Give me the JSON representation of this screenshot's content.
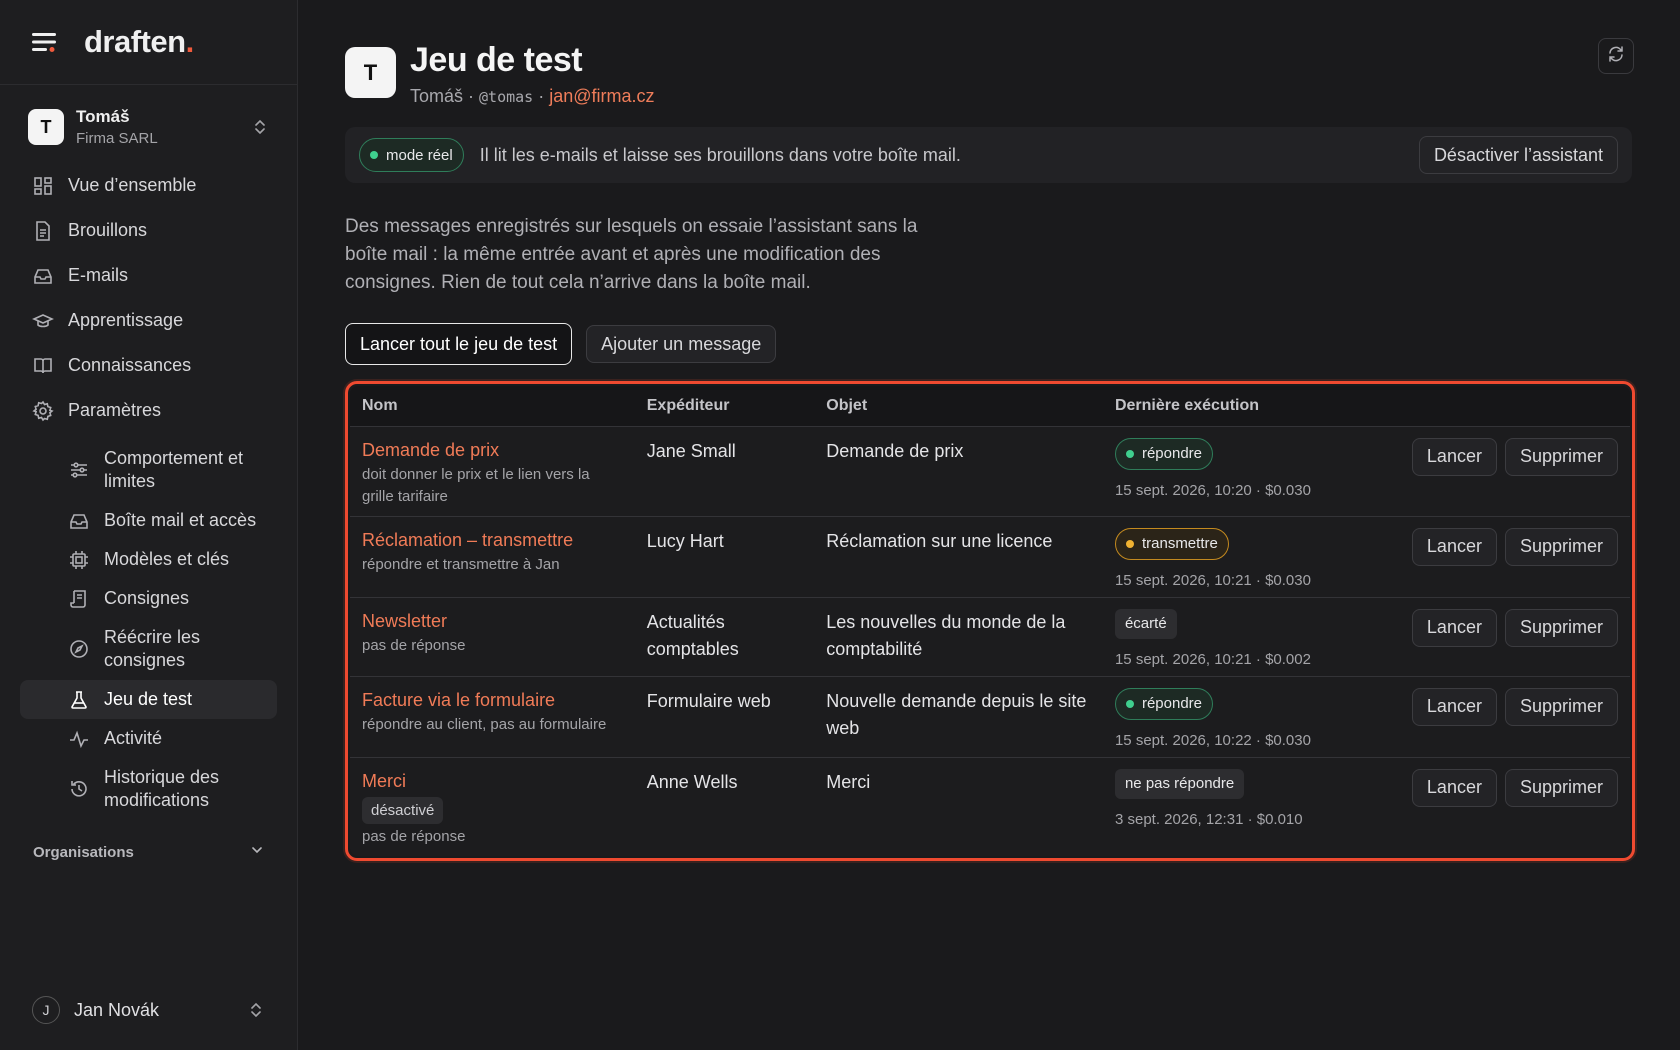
{
  "brand": {
    "name": "draften",
    "dot": "."
  },
  "account": {
    "initial": "T",
    "name": "Tomáš",
    "org": "Firma SARL"
  },
  "nav": [
    {
      "label": "Vue d’ensemble",
      "icon": "grid-icon"
    },
    {
      "label": "Brouillons",
      "icon": "document-icon"
    },
    {
      "label": "E-mails",
      "icon": "inbox-icon"
    },
    {
      "label": "Apprentissage",
      "icon": "graduation-cap-icon"
    },
    {
      "label": "Connaissances",
      "icon": "book-icon"
    },
    {
      "label": "Paramètres",
      "icon": "gear-icon"
    }
  ],
  "subnav": [
    {
      "label": "Comportement et limites",
      "icon": "sliders-icon"
    },
    {
      "label": "Boîte mail et accès",
      "icon": "inbox-icon"
    },
    {
      "label": "Modèles et clés",
      "icon": "chip-icon"
    },
    {
      "label": "Consignes",
      "icon": "scroll-icon"
    },
    {
      "label": "Réécrire les consignes",
      "icon": "compass-icon"
    },
    {
      "label": "Jeu de test",
      "icon": "flask-icon",
      "active": true
    },
    {
      "label": "Activité",
      "icon": "activity-icon"
    },
    {
      "label": "Historique des modifications",
      "icon": "history-icon"
    }
  ],
  "organisations_label": "Organisations",
  "user": {
    "initial": "J",
    "name": "Jan Novák"
  },
  "page": {
    "avatar": "T",
    "title": "Jeu de test",
    "meta_name": "Tomáš · ",
    "meta_handle": "@tomas",
    "meta_sep": " · ",
    "meta_email": "jan@firma.cz"
  },
  "banner": {
    "mode": "mode réel",
    "text": "Il lit les e-mails et laisse ses brouillons dans votre boîte mail.",
    "button": "Désactiver l’assistant"
  },
  "description": "Des messages enregistrés sur lesquels on essaie l’assistant sans la boîte mail : la même entrée avant et après une modification des consignes. Rien de tout cela n’arrive dans la boîte mail.",
  "actions": {
    "run_all": "Lancer tout le jeu de test",
    "add_message": "Ajouter un message"
  },
  "table": {
    "headers": [
      "Nom",
      "Expéditeur",
      "Objet",
      "Dernière exécution",
      ""
    ],
    "run_label": "Lancer",
    "delete_label": "Supprimer",
    "rows": [
      {
        "name": "Demande de prix",
        "tag": "",
        "note": "doit donner le prix et le lien vers la grille tarifaire",
        "sender": "Jane Small",
        "subject": "Demande de prix",
        "status": "répondre",
        "status_color": "green",
        "run": "15 sept. 2026, 10:20 · $0.030"
      },
      {
        "name": "Réclamation – transmettre",
        "tag": "",
        "note": "répondre et transmettre à Jan",
        "sender": "Lucy Hart",
        "subject": "Réclamation sur une licence",
        "status": "transmettre",
        "status_color": "amber",
        "run": "15 sept. 2026, 10:21 · $0.030"
      },
      {
        "name": "Newsletter",
        "tag": "",
        "note": "pas de réponse",
        "sender": "Actualités comptables",
        "subject": "Les nouvelles du monde de la comptabilité",
        "status": "écarté",
        "status_color": "grey",
        "run": "15 sept. 2026, 10:21 · $0.002"
      },
      {
        "name": "Facture via le formulaire",
        "tag": "",
        "note": "répondre au client, pas au formulaire",
        "sender": "Formulaire web",
        "subject": "Nouvelle demande depuis le site web",
        "status": "répondre",
        "status_color": "green",
        "run": "15 sept. 2026, 10:22 · $0.030"
      },
      {
        "name": "Merci",
        "tag": "désactivé",
        "note": "pas de réponse",
        "sender": "Anne Wells",
        "subject": "Merci",
        "status": "ne pas répondre",
        "status_color": "grey",
        "run": "3 sept. 2026, 12:31 · $0.010"
      }
    ]
  },
  "colors": {
    "accent": "#ef7d5a",
    "highlight_border": "#ef4a30",
    "status_green": "#3fcf8e",
    "status_amber": "#f0b232"
  }
}
